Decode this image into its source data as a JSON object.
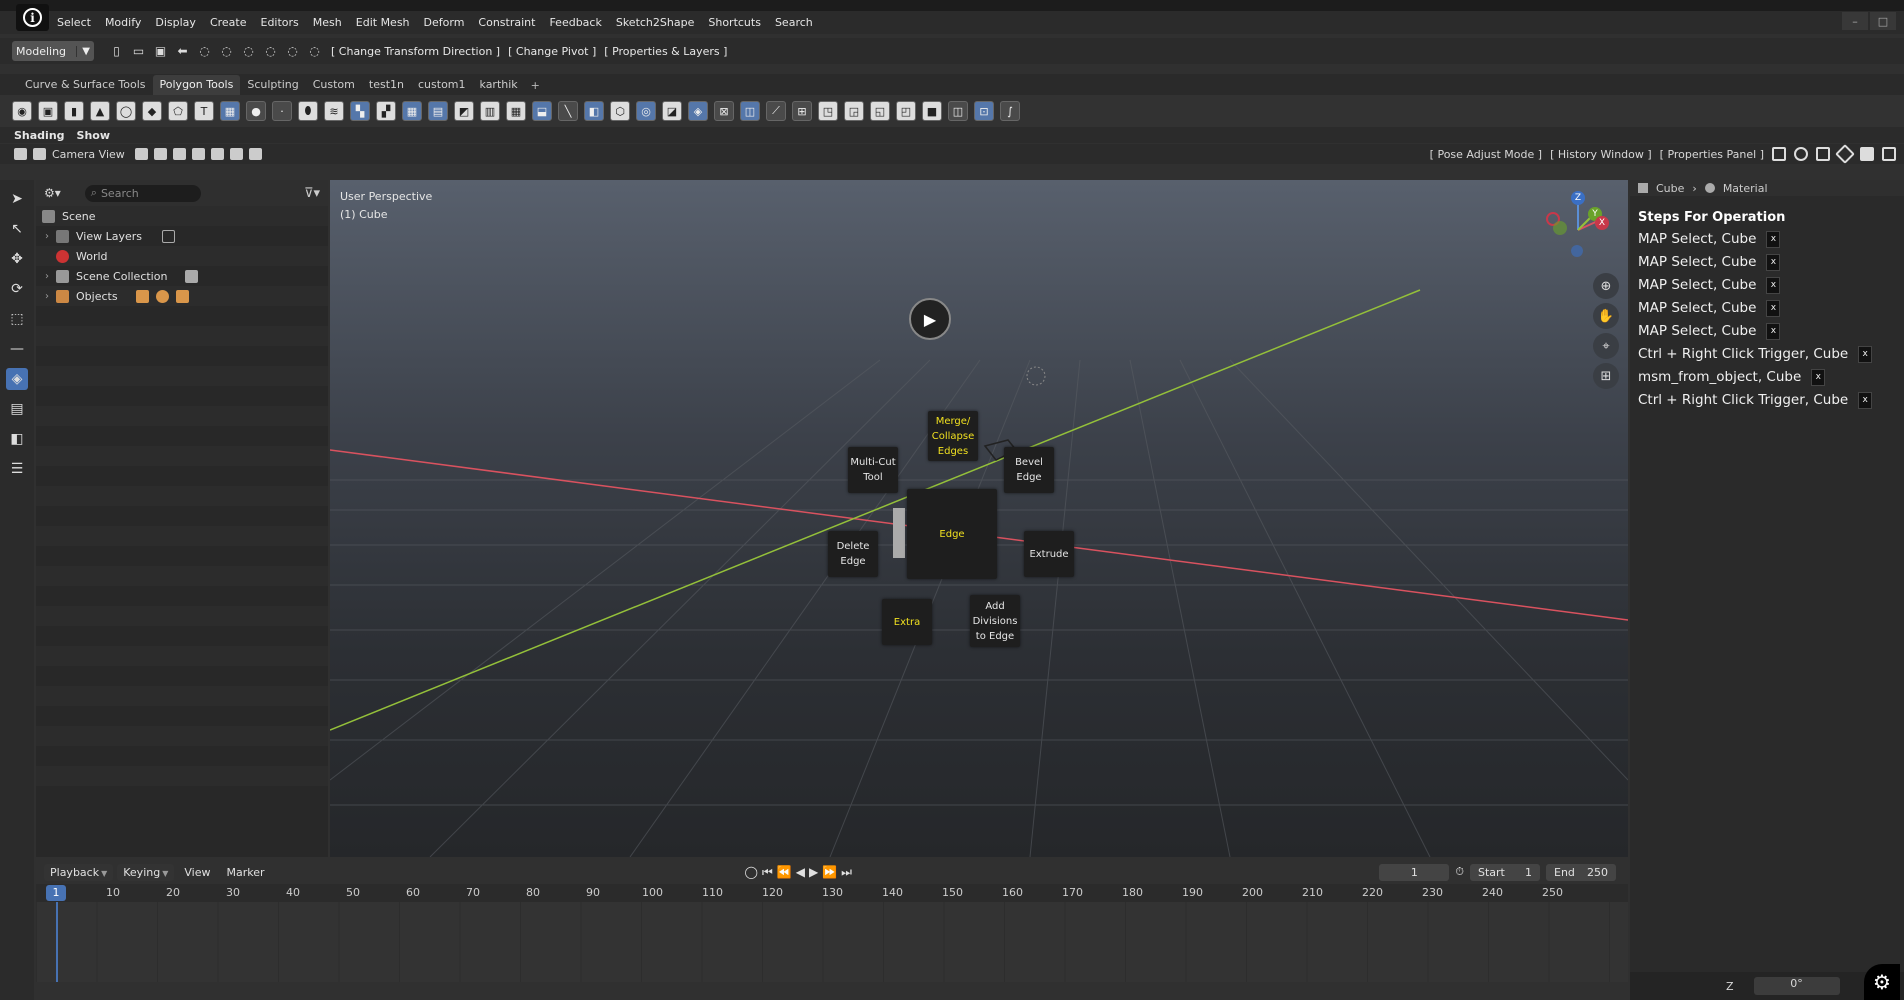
{
  "menubar": {
    "items": [
      "Select",
      "Modify",
      "Display",
      "Create",
      "Editors",
      "Mesh",
      "Edit Mesh",
      "Deform",
      "Constraint",
      "Feedback",
      "Sketch2Shape",
      "Shortcuts",
      "Search"
    ],
    "info_icon": "info-icon"
  },
  "toolbar_row": {
    "mode": "Modeling",
    "brackets": [
      "[ Change Transform Direction ]",
      "[ Change Pivot ]",
      "[ Properties & Layers ]"
    ]
  },
  "tabs": {
    "items": [
      "Curve & Surface Tools",
      "Polygon Tools",
      "Sculpting",
      "Custom",
      "test1n",
      "custom1",
      "karthik"
    ],
    "active": "Polygon Tools",
    "add": "+"
  },
  "shading": {
    "shading_label": "Shading",
    "show_label": "Show"
  },
  "camera_row": {
    "camera_view": "Camera View",
    "right": [
      "[ Pose Adjust Mode ]",
      "[ History Window ]",
      "[ Properties Panel ]"
    ]
  },
  "outliner": {
    "search_placeholder": "Search",
    "rows": {
      "scene": "Scene",
      "view_layers": "View Layers",
      "world": "World",
      "scene_collection": "Scene Collection",
      "objects": "Objects"
    }
  },
  "viewport": {
    "perspective": "User Perspective",
    "object": "(1) Cube",
    "pie": {
      "center": "Edge",
      "top": "Merge/\nCollapse\nEdges",
      "top_left": "Multi-Cut\nTool",
      "top_right": "Bevel Edge",
      "left": "Delete\nEdge",
      "right": "Extrude",
      "bottom_left": "Extra",
      "bottom_right": "Add\nDivisions\nto Edge"
    },
    "gizmo": {
      "z": "Z",
      "y": "Y",
      "x": "X"
    }
  },
  "right_panel": {
    "breadcrumb_object": "Cube",
    "breadcrumb_tab": "Material",
    "title": "Steps For Operation",
    "steps": [
      "MAP Select, Cube",
      "MAP Select, Cube",
      "MAP Select, Cube",
      "MAP Select, Cube",
      "MAP Select, Cube",
      "Ctrl + Right Click Trigger, Cube",
      "msm_from_object, Cube",
      "Ctrl + Right Click Trigger, Cube"
    ],
    "remove_glyph": "x"
  },
  "timeline": {
    "playback": "Playback",
    "keying": "Keying",
    "view": "View",
    "marker": "Marker",
    "current_frame": "1",
    "start_label": "Start",
    "start": "1",
    "end_label": "End",
    "end": "250",
    "ruler_current": "1",
    "ruler_ticks": [
      "10",
      "20",
      "30",
      "40",
      "50",
      "60",
      "70",
      "80",
      "90",
      "100",
      "110",
      "120",
      "130",
      "140",
      "150",
      "160",
      "170",
      "180",
      "190",
      "200",
      "210",
      "220",
      "230",
      "240",
      "250"
    ]
  },
  "bottom": {
    "axis_label": "Z",
    "value": "0°"
  },
  "colors": {
    "accent": "#4772b3",
    "pie_highlight": "#f0e020",
    "x_axis": "#d9525f",
    "y_axis": "#94c03a"
  }
}
